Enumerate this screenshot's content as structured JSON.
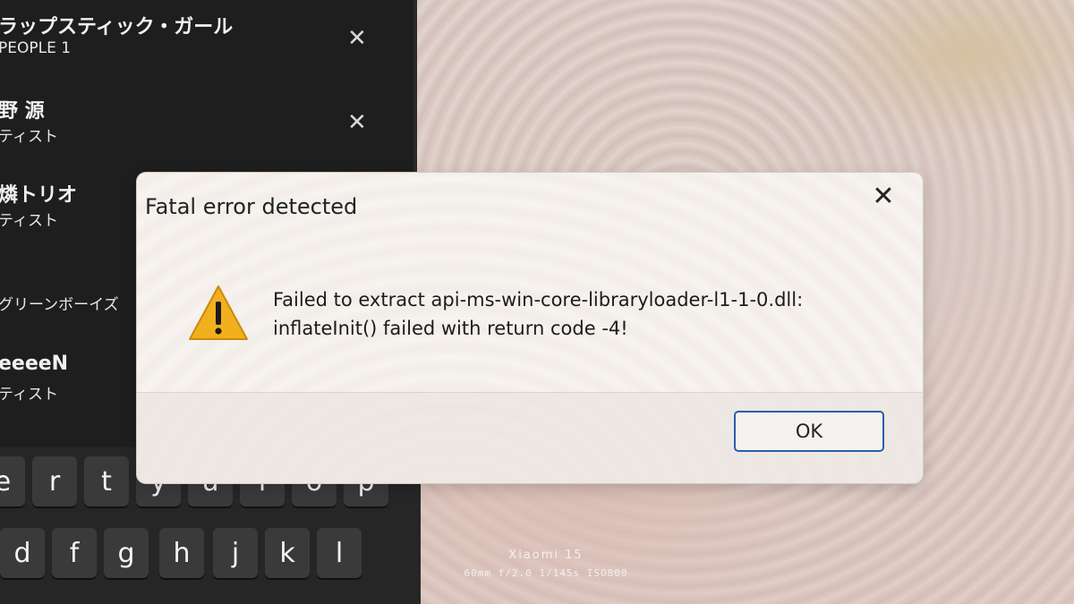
{
  "sidebar": {
    "items": [
      {
        "title": "ラップスティック・ガール",
        "subtitle": "PEOPLE 1",
        "close": "✕"
      },
      {
        "title": "野 源",
        "subtitle": "ティスト",
        "close": "✕"
      },
      {
        "title": "燐トリオ",
        "subtitle": "ティスト"
      },
      {
        "title": "グリーンボーイズ",
        "subtitle": ""
      },
      {
        "title": "eeeeN",
        "subtitle": "ティスト"
      }
    ]
  },
  "keyboard": {
    "row1": [
      "e",
      "r",
      "t",
      "y",
      "u",
      "i",
      "o",
      "p"
    ],
    "row2": [
      "d",
      "f",
      "g",
      "h",
      "j",
      "k",
      "l"
    ]
  },
  "dialog": {
    "title": "Fatal error detected",
    "close_icon": "✕",
    "icon": "warning-icon",
    "message_line1": "Failed to extract api-ms-win-core-libraryloader-l1-1-0.dll:",
    "message_line2": "inflateInit() failed with return code -4!",
    "ok_label": "OK",
    "accent_color": "#2a5fa8",
    "warning_color": "#f2b01e"
  },
  "watermark": {
    "model": "Xiaomi 15",
    "params": "60mm  f/2.0  1/145s  ISO800"
  }
}
